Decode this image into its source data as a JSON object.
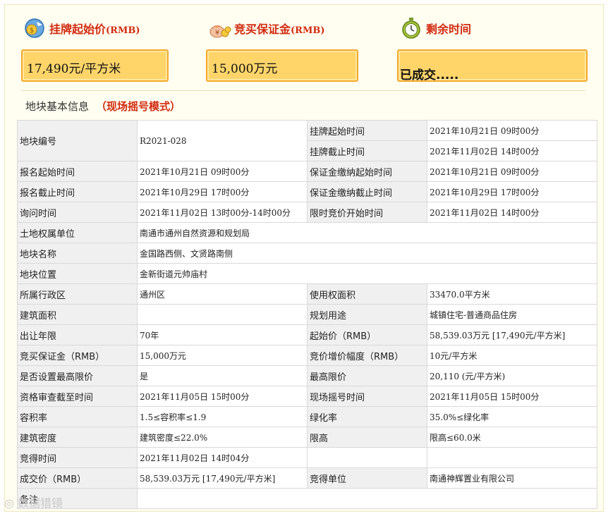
{
  "headers": {
    "price_label": "挂牌起始价",
    "price_unit": "(RMB)",
    "deposit_label": "竞买保证金",
    "deposit_unit": "(RMB)",
    "time_label": "剩余时间"
  },
  "boxes": {
    "price": "17,490元/平方米",
    "deposit": "15,000万元",
    "time": "已成交....."
  },
  "section": {
    "title": "地块基本信息",
    "mode": "（现场摇号模式）"
  },
  "table": {
    "r1": {
      "k1": "地块编号",
      "v1": "R2021-028",
      "k2": "挂牌起始时间",
      "v2": "2021年10月21日 09时00分"
    },
    "r1b": {
      "k2": "挂牌截止时间",
      "v2": "2021年11月02日 14时00分"
    },
    "r2": {
      "k1": "报名起始时间",
      "v1": "2021年10月21日 09时00分",
      "k2": "保证金缴纳起始时间",
      "v2": "2021年10月21日 09时00分"
    },
    "r3": {
      "k1": "报名截止时间",
      "v1": "2021年10月29日 17时00分",
      "k2": "保证金缴纳截止时间",
      "v2": "2021年10月29日 17时00分"
    },
    "r4": {
      "k1": "询问时间",
      "v1": "2021年11月02日 13时00分-14时00分",
      "k2": "限时竞价开始时间",
      "v2": "2021年11月02日 14时00分"
    },
    "r5": {
      "k1": "土地权属单位",
      "v1": "南通市通州自然资源和规划局"
    },
    "r6": {
      "k1": "地块名称",
      "v1": "金国路西侧、文贤路南侧"
    },
    "r7": {
      "k1": "地块位置",
      "v1": "金新街道元帅庙村"
    },
    "r8": {
      "k1": "所属行政区",
      "v1": "通州区",
      "k2": "使用权面积",
      "v2": "33470.0平方米"
    },
    "r9": {
      "k1": "建筑面积",
      "v1": "",
      "k2": "规划用途",
      "v2": "城镇住宅-普通商品住房"
    },
    "r10": {
      "k1": "出让年限",
      "v1": "70年",
      "k2": "起始价（RMB）",
      "v2": "58,539.03万元 [17,490元/平方米]"
    },
    "r11": {
      "k1": "竞买保证金（RMB）",
      "v1": "15,000万元",
      "k2": "竞价增价幅度（RMB）",
      "v2": "10元/平方米"
    },
    "r12": {
      "k1": "是否设置最高限价",
      "v1": "是",
      "k2": "最高限价",
      "v2": "20,110 (元/平方米)"
    },
    "r13": {
      "k1": "资格审查截至时间",
      "v1": "2021年11月05日 15时00分",
      "k2": "现场摇号时间",
      "v2": "2021年11月05日 15时00分"
    },
    "r14": {
      "k1": "容积率",
      "v1": "1.5≤容积率≤1.9",
      "k2": "绿化率",
      "v2": "35.0%≤绿化率"
    },
    "r15": {
      "k1": "建筑密度",
      "v1": "建筑密度≤22.0%",
      "k2": "限高",
      "v2": "限高≤60.0米"
    },
    "r16": {
      "k1": "竞得时间",
      "v1": "2021年11月02日 14时04分",
      "k2": "",
      "v2": ""
    },
    "r17": {
      "k1": "成交价（RMB）",
      "v1": "58,539.03万元 [17,490元/平方米]",
      "k2": "竞得单位",
      "v2": "南通神辉置业有限公司"
    },
    "r18": {
      "k1": "备注",
      "v1": ""
    }
  },
  "watermark": "数据猎镜",
  "colors": {
    "accent_red": "#d22a10",
    "box_fill": "#ffd56a",
    "box_border": "#f3a92b",
    "key_cell": "#f0f0f0"
  },
  "icons": [
    "money-coin-icon",
    "money-bag-icon",
    "clock-icon"
  ]
}
